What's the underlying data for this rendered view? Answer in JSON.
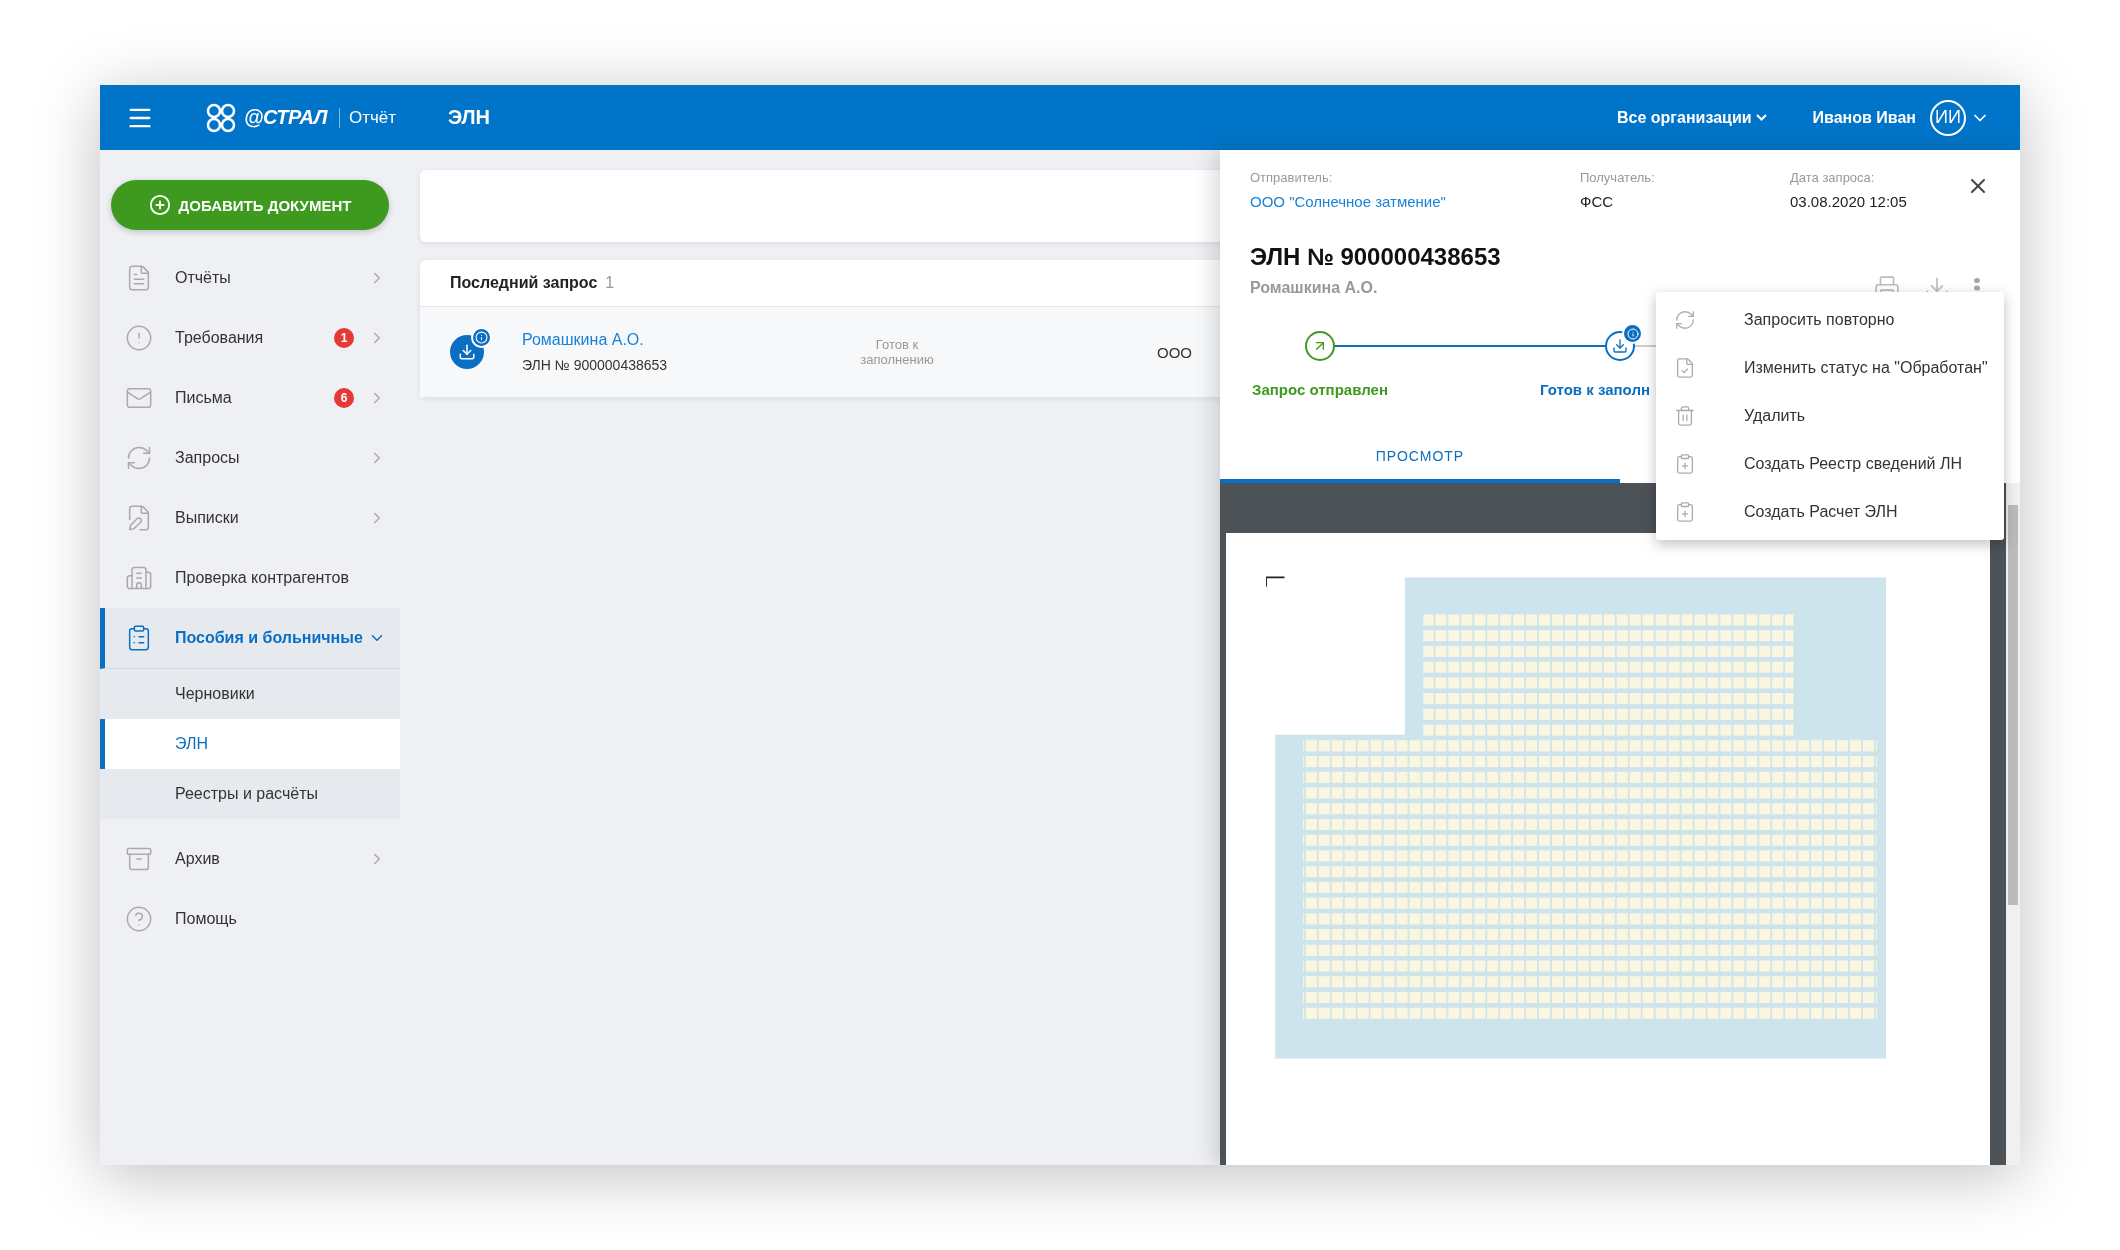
{
  "header": {
    "logo": "@СТРАЛ",
    "product": "Отчёт",
    "title": "ЭЛН",
    "org_selector": "Все организации",
    "user_name": "Иванов Иван",
    "user_initials": "ИИ"
  },
  "sidebar": {
    "add_button": "ДОБАВИТЬ ДОКУМЕНТ",
    "items": [
      {
        "label": "Отчёты",
        "expandable": true,
        "expanded": false,
        "selected": false
      },
      {
        "label": "Требования",
        "badge": "1",
        "expandable": true,
        "expanded": false,
        "selected": false
      },
      {
        "label": "Письма",
        "badge": "6",
        "expandable": true,
        "expanded": false,
        "selected": false
      },
      {
        "label": "Запросы",
        "expandable": true,
        "expanded": false,
        "selected": false
      },
      {
        "label": "Выписки",
        "expandable": true,
        "expanded": false,
        "selected": false
      },
      {
        "label": "Проверка контрагентов",
        "expandable": false,
        "expanded": false,
        "selected": false
      },
      {
        "label": "Пособия и больничные",
        "expandable": true,
        "expanded": true,
        "selected": true,
        "children": [
          {
            "label": "Черновики",
            "selected": false
          },
          {
            "label": "ЭЛН",
            "selected": true
          },
          {
            "label": "Реестры и расчёты",
            "selected": false
          }
        ]
      },
      {
        "label": "Архив",
        "expandable": true,
        "expanded": false,
        "selected": false
      },
      {
        "label": "Помощь",
        "expandable": false,
        "expanded": false,
        "selected": false
      }
    ]
  },
  "list": {
    "title": "Последний запрос",
    "count": "1",
    "rows": [
      {
        "name": "Ромашкина А.О.",
        "number": "ЭЛН № 900000438653",
        "status": "Готов к заполнению",
        "column_3": "ООО"
      }
    ]
  },
  "panel": {
    "sender_label": "Отправитель:",
    "sender": "ООО \"Солнечное затмение\"",
    "recipient_label": "Получатель:",
    "recipient": "ФСС",
    "date_label": "Дата запроса:",
    "date": "03.08.2020 12:05",
    "title": "ЭЛН № 900000438653",
    "subtitle": "Ромашкина А.О.",
    "steps": [
      {
        "label": "Запрос отправлен",
        "kind": "sent"
      },
      {
        "label": "Готов к заполн",
        "kind": "ready"
      }
    ],
    "tabs": [
      {
        "label": "ПРОСМОТР",
        "selected": true
      }
    ],
    "menu": [
      "Запросить повторно",
      "Изменить статус на \"Обработан\"",
      "Удалить",
      "Создать Реестр сведений ЛН",
      "Создать Расчет ЭЛН"
    ]
  }
}
